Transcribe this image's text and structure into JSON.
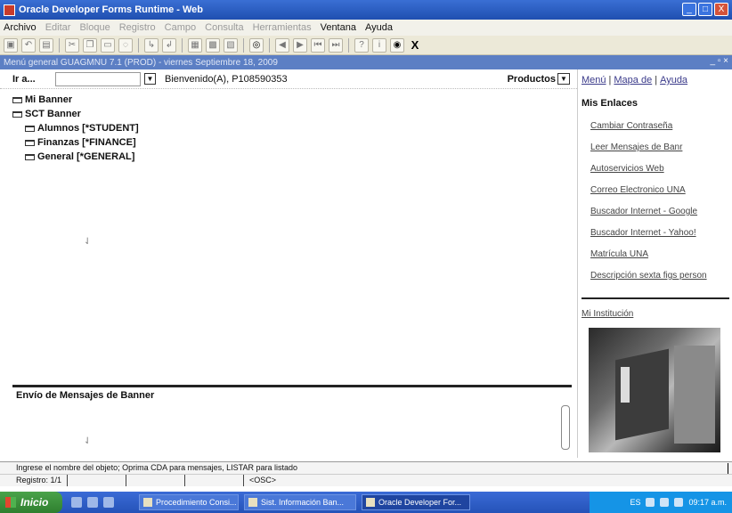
{
  "window": {
    "title": "Oracle Developer Forms Runtime - Web",
    "buttons": [
      "_",
      "□",
      "X"
    ]
  },
  "menu": {
    "items": [
      {
        "label": "Archivo",
        "dim": false
      },
      {
        "label": "Editar",
        "dim": true
      },
      {
        "label": "Bloque",
        "dim": true
      },
      {
        "label": "Registro",
        "dim": true
      },
      {
        "label": "Campo",
        "dim": true
      },
      {
        "label": "Consulta",
        "dim": true
      },
      {
        "label": "Herramientas",
        "dim": true
      },
      {
        "label": "Ventana",
        "dim": false
      },
      {
        "label": "Ayuda",
        "dim": false
      }
    ]
  },
  "toolbar": {
    "exit_label": "X"
  },
  "inner_window": {
    "title": "Menú general  GUAGMNU  7.1  (PROD) - viernes Septiembre 18, 2009",
    "controls": "_ ▫ ×"
  },
  "nav": {
    "goto_label": "Ir a...",
    "goto_value": "",
    "welcome": "Bienvenido(A), P108590353",
    "productos_label": "Productos"
  },
  "tree": {
    "root1": "Mi Banner",
    "root2": "SCT Banner",
    "children": [
      "Alumnos [*STUDENT]",
      "Finanzas [*FINANCE]",
      "General [*GENERAL]"
    ]
  },
  "messages": {
    "title": "Envío de Mensajes de Banner"
  },
  "right_panel": {
    "top_links": [
      "Menú",
      "Mapa de",
      "Ayuda"
    ],
    "heading": "Mis Enlaces",
    "links": [
      "Cambiar Contraseña",
      "Leer Mensajes de Banr",
      "Autoservicios Web",
      "Correo Electronico UNA",
      "Buscador Internet - Google",
      "Buscador Internet - Yahoo!",
      "Matrícula UNA",
      "Descripción sexta figs person"
    ],
    "institution_link": "Mi Institución"
  },
  "status": {
    "hint": "Ingrese el nombre del objeto; Oprima CDA para mensajes, LISTAR para listado",
    "record": "Registro: 1/1",
    "osc": "<OSC>"
  },
  "taskbar": {
    "start_label": "Inicio",
    "tasks": [
      "Procedimiento Consi...",
      "Sist. Información Ban...",
      "Oracle Developer For..."
    ],
    "tray_lang": "ES",
    "clock": "09:17 a.m."
  }
}
